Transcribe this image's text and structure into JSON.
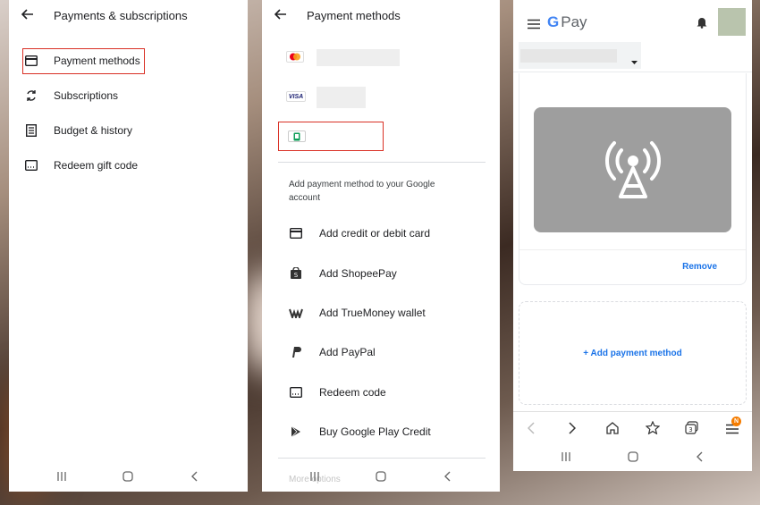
{
  "panel1": {
    "title": "Payments & subscriptions",
    "items": [
      {
        "label": "Payment methods",
        "icon": "credit-card-icon"
      },
      {
        "label": "Subscriptions",
        "icon": "sync-icon"
      },
      {
        "label": "Budget & history",
        "icon": "list-icon"
      },
      {
        "label": "Redeem gift code",
        "icon": "gift-code-icon"
      }
    ]
  },
  "panel2": {
    "title": "Payment methods",
    "card_brands": [
      "mastercard",
      "VISA",
      "play-balance"
    ],
    "visa_text": "VISA",
    "add_heading": "Add payment method to your Google account",
    "options": [
      {
        "label": "Add credit or debit card",
        "icon": "credit-card-icon"
      },
      {
        "label": "Add ShopeePay",
        "icon": "shopeepay-icon"
      },
      {
        "label": "Add TrueMoney wallet",
        "icon": "truemoney-icon"
      },
      {
        "label": "Add PayPal",
        "icon": "paypal-icon"
      },
      {
        "label": "Redeem code",
        "icon": "redeem-code-icon"
      },
      {
        "label": "Buy Google Play Credit",
        "icon": "play-icon"
      }
    ],
    "footer_text": "More options"
  },
  "panel3": {
    "logo_g": "G",
    "logo_pay": "Pay",
    "remove_label": "Remove",
    "add_method_label": "+ Add payment method",
    "badge": "N",
    "tab_count": "3"
  },
  "colors": {
    "accent_blue": "#1a73e8",
    "red_highlight": "#d93025",
    "card_gray": "#9e9e9e"
  }
}
